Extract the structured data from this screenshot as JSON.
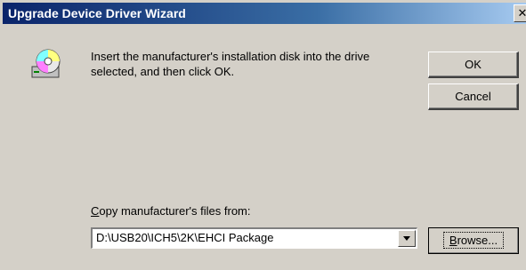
{
  "window": {
    "title": "Upgrade Device Driver Wizard",
    "close_glyph": "✕"
  },
  "message": {
    "icon": "install-disk-icon",
    "line1": "Insert the manufacturer's installation disk into the drive",
    "line2": "selected, and then click OK."
  },
  "buttons": {
    "ok": "OK",
    "cancel": "Cancel",
    "browse_first": "B",
    "browse_rest": "rowse..."
  },
  "copy_from": {
    "label_first": "C",
    "label_rest": "opy manufacturer's files from:",
    "value": "D:\\USB20\\ICH5\\2K\\EHCI Package"
  },
  "colors": {
    "titlebar": "#0a246a",
    "face": "#d4d0c8"
  }
}
